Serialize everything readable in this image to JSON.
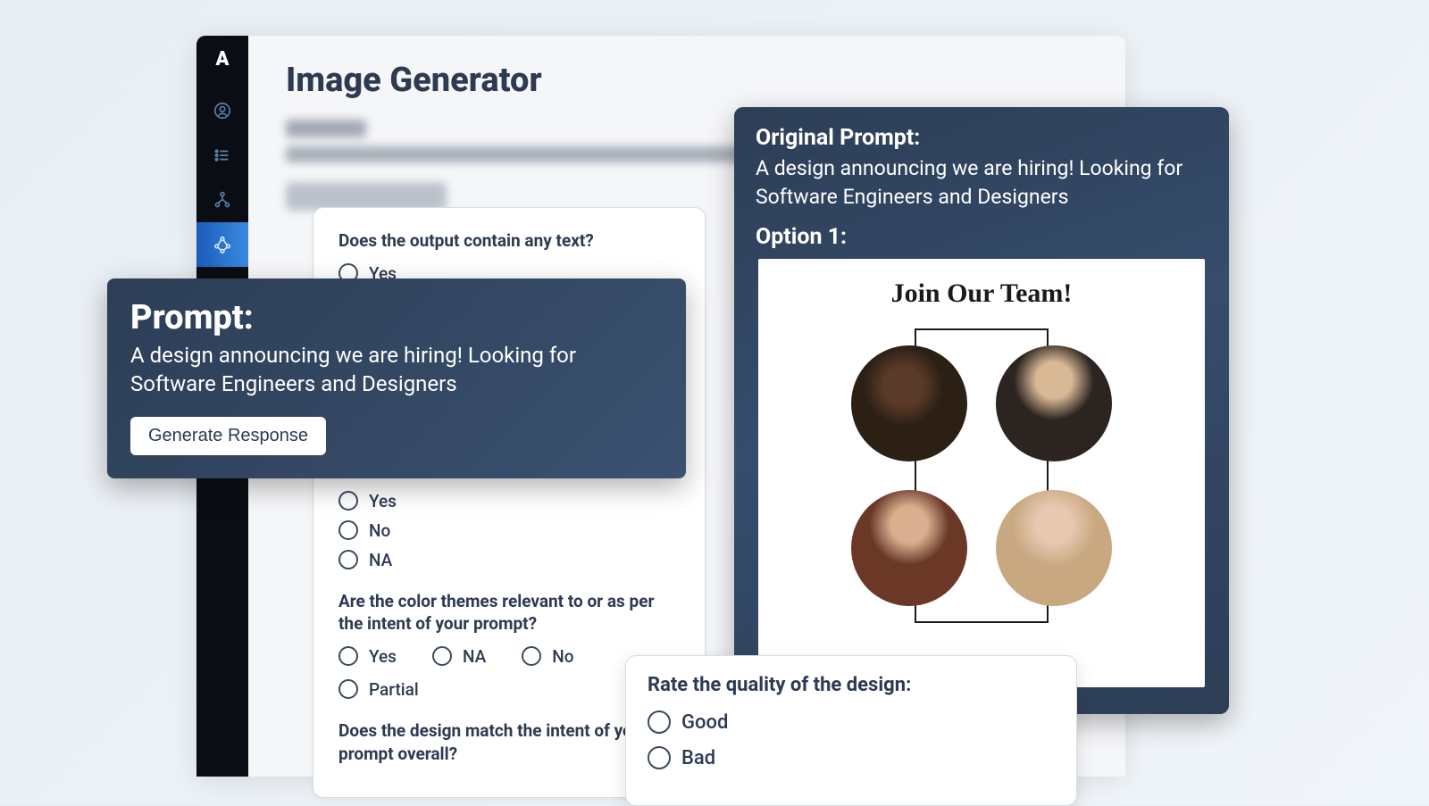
{
  "app": {
    "logo": "A",
    "title": "Image Generator"
  },
  "questions": {
    "q1": {
      "title": "Does the output contain any text?",
      "opts": [
        "Yes"
      ]
    },
    "q2": {
      "opts": [
        "Yes",
        "No",
        "NA"
      ]
    },
    "q3": {
      "title": "Are the color themes relevant to or as per the intent of your prompt?",
      "opts": [
        "Yes",
        "NA",
        "No",
        "Partial"
      ]
    },
    "q4": {
      "title": "Does the design match the intent of your prompt overall?"
    }
  },
  "prompt": {
    "heading": "Prompt:",
    "text": "A design announcing we are hiring! Looking for Software Engineers and Designers",
    "button": "Generate Response"
  },
  "original": {
    "label": "Original Prompt:",
    "text": "A design announcing we are hiring! Looking for Software Engineers and Designers",
    "option_label": "Option 1:",
    "design_title": "Join Our Team!"
  },
  "rating": {
    "title": "Rate the quality of the design:",
    "opts": [
      "Good",
      "Bad"
    ]
  }
}
